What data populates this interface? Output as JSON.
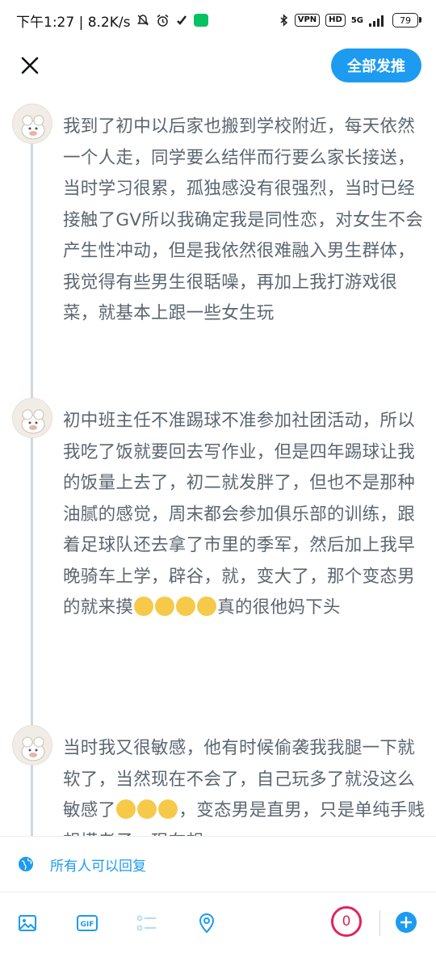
{
  "status_bar": {
    "time_speed": "下午1:27 | 8.2K/s",
    "vpn": "VPN",
    "hd": "HD",
    "network": "5G",
    "battery": "79"
  },
  "header": {
    "send_all_label": "全部发推"
  },
  "tweets": [
    {
      "text": "我到了初中以后家也搬到学校附近，每天依然一个人走，同学要么结伴而行要么家长接送，当时学习很累，孤独感没有很强烈，当时已经接触了GV所以我确定我是同性恋，对女生不会产生性冲动，但是我依然很难融入男生群体，我觉得有些男生很聒噪，再加上我打游戏很菜，就基本上跟一些女生玩"
    },
    {
      "text_before_emoji": "初中班主任不准踢球不准参加社团活动，所以我吃了饭就要回去写作业，但是四年踢球让我的饭量上去了，初二就发胖了，但也不是那种油腻的感觉，周末都会参加俱乐部的训练，跟着足球队还去拿了市里的季军，然后加上我早晚骑车上学，辟谷，就，变大了，那个变态男的就来摸",
      "emojis": [
        "grinning-sweat-emoji",
        "grinning-sweat-emoji",
        "grinning-sweat-emoji",
        "grinning-sweat-emoji"
      ],
      "text_after_emoji": "真的很他妈下头"
    },
    {
      "text_before_emoji": "当时我又很敏感，他有时候偷袭我我腿一下就软了，当然现在不会了，自己玩多了就没这么敏感了",
      "emojis": [
        "sad-sweat-emoji",
        "thinking-emoji",
        "thinking-emoji"
      ],
      "text_after_emoji": "，变态男是直男，只是单纯手贱想摸老子，现在想"
    }
  ],
  "reply_setting": {
    "label": "所有人可以回复"
  },
  "toolbar": {
    "char_counter": "0"
  },
  "colors": {
    "accent": "#1d9bf0",
    "counter_red": "#e0245e",
    "text_gray": "#5b6670"
  }
}
